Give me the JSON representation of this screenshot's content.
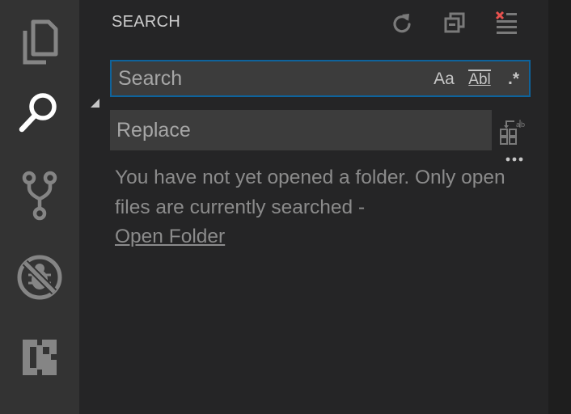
{
  "activity_bar": {
    "items": [
      {
        "name": "explorer",
        "icon": "files-icon"
      },
      {
        "name": "search",
        "icon": "search-icon",
        "active": true
      },
      {
        "name": "source-control",
        "icon": "git-branch-icon"
      },
      {
        "name": "debug",
        "icon": "debug-disabled-icon"
      },
      {
        "name": "extensions",
        "icon": "extensions-icon"
      }
    ]
  },
  "search_view": {
    "title": "SEARCH",
    "actions": [
      "refresh-icon",
      "collapse-all-icon",
      "clear-results-icon"
    ],
    "search_input": {
      "value": "",
      "placeholder": "Search"
    },
    "options": {
      "match_case": "Aa",
      "whole_word": "Abl",
      "regex": ".*"
    },
    "replace_input": {
      "value": "",
      "placeholder": "Replace"
    },
    "message": {
      "text": "You have not yet opened a folder. Only open files are currently searched -",
      "link": "Open Folder"
    }
  },
  "colors": {
    "activity_bar_bg": "#333333",
    "sidebar_bg": "#252526",
    "input_bg": "#3c3c3c",
    "focus_border": "#0e639c",
    "clear_icon_accent": "#e8524f"
  }
}
